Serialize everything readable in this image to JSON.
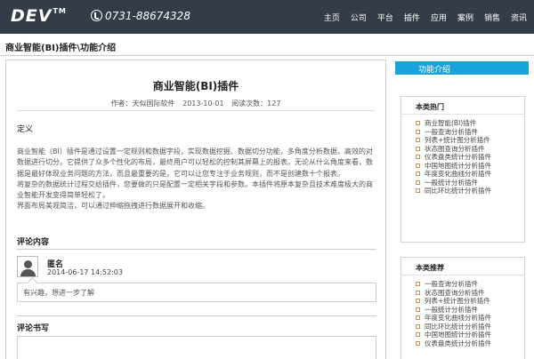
{
  "header": {
    "logo": "DEV",
    "logo_tm": "TM",
    "phone": "0731-88674328",
    "nav": [
      "主页",
      "公司",
      "平台",
      "插件",
      "应用",
      "案例",
      "销售",
      "资讯"
    ]
  },
  "breadcrumb": "商业智能(BI)插件\\功能介绍",
  "article": {
    "title": "商业智能(BI)插件",
    "author": "作者：天似国际软件",
    "date": "2013-10-01",
    "views": "阅读次数：127",
    "section_title": "定义",
    "paragraphs": [
      "商业智能（BI）插件是通过设置一定规则和数据字段，实现数据挖掘、数据切分功能，多角度分析数据，高效的对数据进行切分。它提供了众多个性化的布局，最终用户可以轻松的控制其屏幕上的报表。无论从什么角度来看，数据是最好体现业务问题的方法，而且最重要的是，它可以让您专注于业务规则，而不是创建数十个报表。",
      "将复杂的数据统计过程交给插件，您要做的只是配置一定相关字段和参数。本插件将原本复杂且技术难度极大的商业智能开发变得简单轻松了。",
      "界面布局美观简洁，可以通过伸缩拖拽进行数据展开和收缩。"
    ]
  },
  "comments": {
    "title": "评论内容",
    "items": [
      {
        "name": "匿名",
        "time": "2014-06-17 14:52:03",
        "text": "有兴趣，想进一步了解"
      }
    ],
    "write_title": "评论书写"
  },
  "sidebar": {
    "tab_label": "功能介绍",
    "hot": {
      "title": "本类热门",
      "items": [
        "商业智能(BI)插件",
        "一般查询分析插件",
        "列表+统计图分析插件",
        "状态图查询分析插件",
        "仪表盘类统计分析插件",
        "中国地图统计分析插件",
        "年度变化曲线分析插件",
        "一般统计分析插件",
        "同比环比统计分析插件"
      ]
    },
    "recommend": {
      "title": "本类推荐",
      "items": [
        "一般查询分析插件",
        "状态图查询分析插件",
        "列表+统计图分析插件",
        "一般统计分析插件",
        "年度变化曲线分析插件",
        "同比环比统计分析插件",
        "中国地图统计分析插件",
        "仪表盘类统计分析插件"
      ]
    }
  }
}
